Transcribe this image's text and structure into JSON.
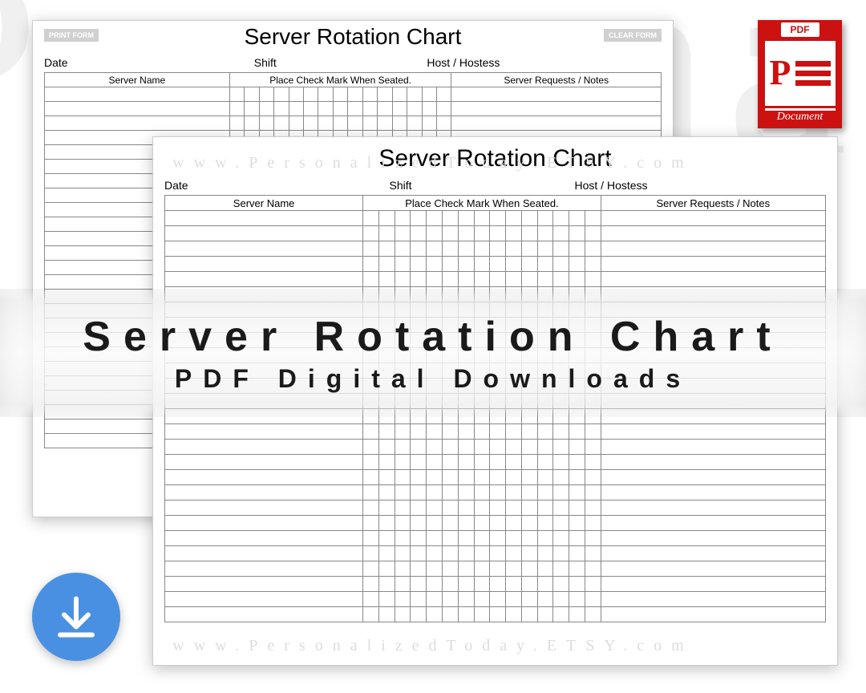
{
  "bg_watermark": "PersonalizedToday",
  "chart": {
    "title": "Server Rotation Chart",
    "print_btn": "PRINT FORM",
    "clear_btn": "CLEAR FORM",
    "meta": {
      "date": "Date",
      "shift": "Shift",
      "host": "Host / Hostess"
    },
    "headers": {
      "name": "Server Name",
      "check": "Place Check Mark When Seated.",
      "notes": "Server Requests / Notes"
    },
    "check_columns": 15,
    "back_rows": 25,
    "front_rows": 27
  },
  "wm_top": "www.PersonalizedToday.ETSY.com",
  "wm_bottom": "www.PersonalizedToday.ETSY.com",
  "ribbon": {
    "line1": "Server Rotation Chart",
    "line2": "PDF Digital Downloads"
  },
  "pdf_badge": {
    "tab": "PDF",
    "letter": "P",
    "label": "Document"
  }
}
